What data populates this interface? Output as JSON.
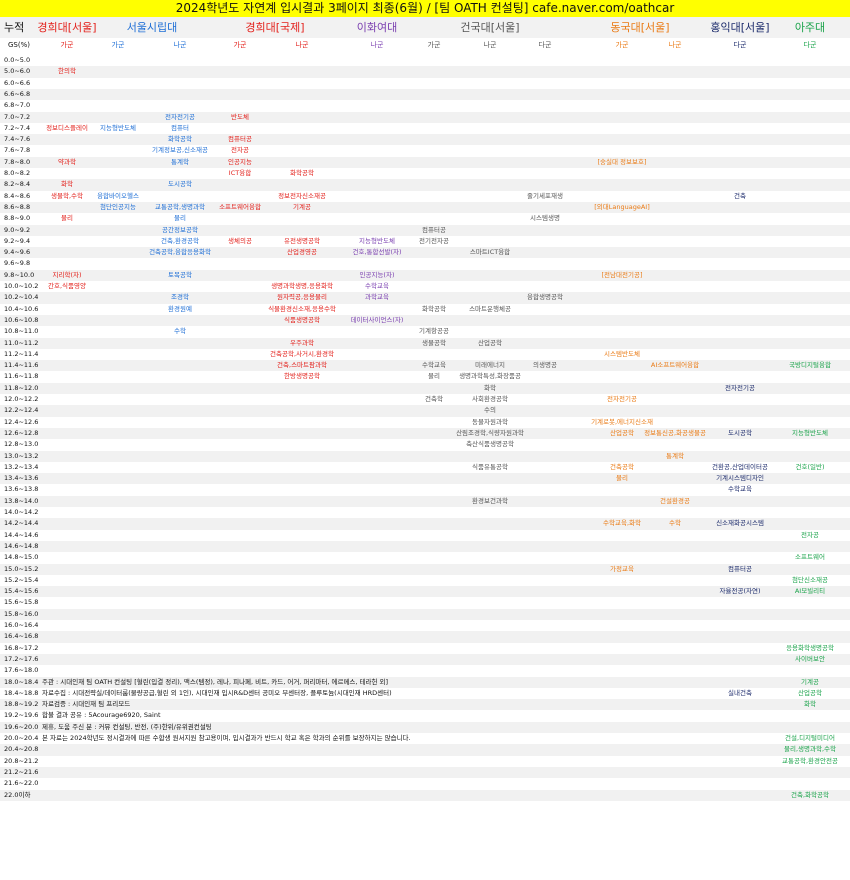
{
  "title": "2024학년도 자연계 입시결과 3페이지 최종(6월) / [팀 OATH 컨설팅] cafe.naver.com/oathcar",
  "header": {
    "corner": "누적",
    "corner2": "GS(%)",
    "universities": [
      {
        "name": "경희대[서울]",
        "color": "red"
      },
      {
        "name": "서울시립대",
        "color": "blue"
      },
      {
        "name": "경희대[국제]",
        "color": "red"
      },
      {
        "name": "이화여대",
        "color": "purple"
      },
      {
        "name": "건국대[서울]",
        "color": "gray"
      },
      {
        "name": "동국대[서울]",
        "color": "orange"
      },
      {
        "name": "홍익대[서울]",
        "color": "navy"
      },
      {
        "name": "아주대",
        "color": "green"
      }
    ],
    "groups": [
      {
        "label": "가군",
        "color": "red"
      },
      {
        "label": "가군",
        "color": "blue"
      },
      {
        "label": "나군",
        "color": "blue"
      },
      {
        "label": "가군",
        "color": "red"
      },
      {
        "label": "나군",
        "color": "red"
      },
      {
        "label": "나군",
        "color": "purple"
      },
      {
        "label": "가군",
        "color": "gray"
      },
      {
        "label": "나군",
        "color": "gray"
      },
      {
        "label": "다군",
        "color": "gray"
      },
      {
        "label": "가군",
        "color": "orange"
      },
      {
        "label": "나군",
        "color": "orange"
      },
      {
        "label": "다군",
        "color": "navy"
      },
      {
        "label": "다군",
        "color": "green"
      }
    ]
  },
  "rows": [
    {
      "label": "0.0~5.0",
      "cells": []
    },
    {
      "label": "5.0~6.0",
      "cells": [
        {
          "col": 0,
          "text": "한의학"
        }
      ]
    },
    {
      "label": "6.0~6.6",
      "cells": []
    },
    {
      "label": "6.6~6.8",
      "cells": []
    },
    {
      "label": "6.8~7.0",
      "cells": []
    },
    {
      "label": "7.0~7.2",
      "cells": [
        {
          "col": 2,
          "text": "전자전기공"
        },
        {
          "col": 3,
          "text": "반도체"
        }
      ]
    },
    {
      "label": "7.2~7.4",
      "cells": [
        {
          "col": 0,
          "text": "정보디스플레이"
        },
        {
          "col": 1,
          "text": "지능형반도체"
        },
        {
          "col": 2,
          "text": "컴퓨터"
        }
      ]
    },
    {
      "label": "7.4~7.6",
      "cells": [
        {
          "col": 2,
          "text": "화학공학"
        },
        {
          "col": 3,
          "text": "컴퓨터공"
        }
      ]
    },
    {
      "label": "7.6~7.8",
      "cells": [
        {
          "col": 2,
          "text": "기계정보공,신소재공"
        },
        {
          "col": 3,
          "text": "전자공"
        }
      ]
    },
    {
      "label": "7.8~8.0",
      "cells": [
        {
          "col": 0,
          "text": "약과학"
        },
        {
          "col": 2,
          "text": "통계학"
        },
        {
          "col": 3,
          "text": "인공지능"
        },
        {
          "col": 9,
          "text": "[숭실대 정보보호]"
        }
      ]
    },
    {
      "label": "8.0~8.2",
      "cells": [
        {
          "col": 3,
          "text": "ICT융합"
        },
        {
          "col": 4,
          "text": "화학공학"
        }
      ]
    },
    {
      "label": "8.2~8.4",
      "cells": [
        {
          "col": 0,
          "text": "화학"
        },
        {
          "col": 2,
          "text": "도시공학"
        }
      ]
    },
    {
      "label": "8.4~8.6",
      "cells": [
        {
          "col": 0,
          "text": "생물학,수학"
        },
        {
          "col": 1,
          "text": "융합바이오헬스"
        },
        {
          "col": 4,
          "text": "정보전자신소재공"
        },
        {
          "col": 8,
          "text": "줄기세포재생"
        },
        {
          "col": 11,
          "text": "건축"
        }
      ]
    },
    {
      "label": "8.6~8.8",
      "cells": [
        {
          "col": 1,
          "text": "첨단인공지능"
        },
        {
          "col": 2,
          "text": "교통공학,생명과학"
        },
        {
          "col": 3,
          "text": "소프트웨어융합"
        },
        {
          "col": 4,
          "text": "기계공"
        },
        {
          "col": 9,
          "text": "[외대LanguageAI]"
        }
      ]
    },
    {
      "label": "8.8~9.0",
      "cells": [
        {
          "col": 0,
          "text": "물리"
        },
        {
          "col": 2,
          "text": "물리"
        },
        {
          "col": 8,
          "text": "시스템생명"
        }
      ]
    },
    {
      "label": "9.0~9.2",
      "cells": [
        {
          "col": 2,
          "text": "공간정보공학"
        },
        {
          "col": 6,
          "text": "컴퓨터공"
        }
      ]
    },
    {
      "label": "9.2~9.4",
      "cells": [
        {
          "col": 2,
          "text": "건축,환경공학"
        },
        {
          "col": 3,
          "text": "생체의공"
        },
        {
          "col": 4,
          "text": "유전생명공학"
        },
        {
          "col": 5,
          "text": "지능형반도체"
        },
        {
          "col": 6,
          "text": "전기전자공"
        }
      ]
    },
    {
      "label": "9.4~9.6",
      "cells": [
        {
          "col": 2,
          "text": "건축공학,융합응용화학"
        },
        {
          "col": 4,
          "text": "산업경영공"
        },
        {
          "col": 5,
          "text": "건호,통합선발(자)"
        },
        {
          "col": 7,
          "text": "스마트ICT융합"
        }
      ]
    },
    {
      "label": "9.6~9.8",
      "cells": []
    },
    {
      "label": "9.8~10.0",
      "cells": [
        {
          "col": 0,
          "text": "지리학(자)"
        },
        {
          "col": 2,
          "text": "토목공학"
        },
        {
          "col": 5,
          "text": "인공지능(자)"
        },
        {
          "col": 9,
          "text": "[전남대전기공]"
        }
      ]
    },
    {
      "label": "10.0~10.2",
      "cells": [
        {
          "col": 0,
          "text": "간호,식품영양"
        },
        {
          "col": 4,
          "text": "생명과학생명,응용화학"
        },
        {
          "col": 5,
          "text": "수학교육"
        }
      ]
    },
    {
      "label": "10.2~10.4",
      "cells": [
        {
          "col": 2,
          "text": "조경학"
        },
        {
          "col": 4,
          "text": "원자력공,응용물리"
        },
        {
          "col": 5,
          "text": "과학교육"
        },
        {
          "col": 8,
          "text": "융합생명공학"
        }
      ]
    },
    {
      "label": "10.4~10.6",
      "cells": [
        {
          "col": 2,
          "text": "환경원예"
        },
        {
          "col": 4,
          "text": "식물환경신소재,응용수학"
        },
        {
          "col": 6,
          "text": "화학공학"
        },
        {
          "col": 7,
          "text": "스마트운행체공"
        }
      ]
    },
    {
      "label": "10.6~10.8",
      "cells": [
        {
          "col": 4,
          "text": "식품생명공학"
        },
        {
          "col": 5,
          "text": "데이터사이언스(자)"
        }
      ]
    },
    {
      "label": "10.8~11.0",
      "cells": [
        {
          "col": 2,
          "text": "수학"
        },
        {
          "col": 6,
          "text": "기계항공공"
        }
      ]
    },
    {
      "label": "11.0~11.2",
      "cells": [
        {
          "col": 4,
          "text": "우주과학"
        },
        {
          "col": 6,
          "text": "생물공학"
        },
        {
          "col": 7,
          "text": "산업공학"
        }
      ]
    },
    {
      "label": "11.2~11.4",
      "cells": [
        {
          "col": 4,
          "text": "건축공학,사거시,환경학"
        },
        {
          "col": 9,
          "text": "시스템반도체"
        }
      ]
    },
    {
      "label": "11.4~11.6",
      "cells": [
        {
          "col": 4,
          "text": "건축,스마트팜과학"
        },
        {
          "col": 6,
          "text": "수학교육"
        },
        {
          "col": 7,
          "text": "미래에너지"
        },
        {
          "col": 8,
          "text": "의생명공"
        },
        {
          "col": 10,
          "text": "AI소프트웨어융합"
        },
        {
          "col": 12,
          "text": "국방디지털융합"
        }
      ]
    },
    {
      "label": "11.6~11.8",
      "cells": [
        {
          "col": 4,
          "text": "한방생명공학"
        },
        {
          "col": 6,
          "text": "물리"
        },
        {
          "col": 7,
          "text": "생명과학특성,화장품공"
        }
      ]
    },
    {
      "label": "11.8~12.0",
      "cells": [
        {
          "col": 7,
          "text": "화학"
        },
        {
          "col": 11,
          "text": "전자전기공"
        }
      ]
    },
    {
      "label": "12.0~12.2",
      "cells": [
        {
          "col": 6,
          "text": "건축학"
        },
        {
          "col": 7,
          "text": "사회환경공학"
        },
        {
          "col": 9,
          "text": "전자전기공"
        }
      ]
    },
    {
      "label": "12.2~12.4",
      "cells": [
        {
          "col": 7,
          "text": "수의"
        }
      ]
    },
    {
      "label": "12.4~12.6",
      "cells": [
        {
          "col": 7,
          "text": "동물자원과학"
        },
        {
          "col": 9,
          "text": "기계로봇,에너지신소재"
        }
      ]
    },
    {
      "label": "12.6~12.8",
      "cells": [
        {
          "col": 7,
          "text": "산림조경학,식량자원과학"
        },
        {
          "col": 9,
          "text": "산업공학"
        },
        {
          "col": 10,
          "text": "정보통신공,화공생물공"
        },
        {
          "col": 11,
          "text": "도시공학"
        },
        {
          "col": 12,
          "text": "지능형반도체"
        }
      ]
    },
    {
      "label": "12.8~13.0",
      "cells": [
        {
          "col": 7,
          "text": "축산식품생명공학"
        }
      ]
    },
    {
      "label": "13.0~13.2",
      "cells": [
        {
          "col": 10,
          "text": "통계학"
        }
      ]
    },
    {
      "label": "13.2~13.4",
      "cells": [
        {
          "col": 7,
          "text": "식품유통공학"
        },
        {
          "col": 9,
          "text": "건축공학"
        },
        {
          "col": 11,
          "text": "건환공,산업데이터공"
        },
        {
          "col": 12,
          "text": "건호(일반)"
        }
      ]
    },
    {
      "label": "13.4~13.6",
      "cells": [
        {
          "col": 9,
          "text": "물리"
        },
        {
          "col": 11,
          "text": "기계시스템디자인"
        }
      ]
    },
    {
      "label": "13.6~13.8",
      "cells": [
        {
          "col": 11,
          "text": "수학교육"
        }
      ]
    },
    {
      "label": "13.8~14.0",
      "cells": [
        {
          "col": 7,
          "text": "환경보건과학"
        },
        {
          "col": 10,
          "text": "건설환경공"
        }
      ]
    },
    {
      "label": "14.0~14.2",
      "cells": []
    },
    {
      "label": "14.2~14.4",
      "cells": [
        {
          "col": 9,
          "text": "수학교육,화학"
        },
        {
          "col": 10,
          "text": "수학"
        },
        {
          "col": 11,
          "text": "신소재화공시스템"
        }
      ]
    },
    {
      "label": "14.4~14.6",
      "cells": [
        {
          "col": 12,
          "text": "전자공"
        }
      ]
    },
    {
      "label": "14.6~14.8",
      "cells": []
    },
    {
      "label": "14.8~15.0",
      "cells": [
        {
          "col": 12,
          "text": "소프트웨어"
        }
      ]
    },
    {
      "label": "15.0~15.2",
      "cells": [
        {
          "col": 9,
          "text": "가정교육"
        },
        {
          "col": 11,
          "text": "컴퓨터공"
        }
      ]
    },
    {
      "label": "15.2~15.4",
      "cells": [
        {
          "col": 12,
          "text": "첨단신소재공"
        }
      ]
    },
    {
      "label": "15.4~15.6",
      "cells": [
        {
          "col": 11,
          "text": "자율전공(자연)"
        },
        {
          "col": 12,
          "text": "AI모빌리티"
        }
      ]
    },
    {
      "label": "15.6~15.8",
      "cells": []
    },
    {
      "label": "15.8~16.0",
      "cells": []
    },
    {
      "label": "16.0~16.4",
      "cells": []
    },
    {
      "label": "16.4~16.8",
      "cells": []
    },
    {
      "label": "16.8~17.2",
      "cells": [
        {
          "col": 12,
          "text": "응용화학생명공학"
        }
      ]
    },
    {
      "label": "17.2~17.6",
      "cells": [
        {
          "col": 12,
          "text": "사이버보안"
        }
      ]
    },
    {
      "label": "17.6~18.0",
      "cells": []
    },
    {
      "label": "18.0~18.4",
      "note": "주관 : 시대인재 팀 OATH 컨설팅 [혈린(입결 정리), 맥스(템정), 레나, 피나페, 비트, 카드, 어거, 퍼리마터, 에르메스, 테라헌 외]",
      "cells": [
        {
          "col": 12,
          "text": "기계공"
        }
      ]
    },
    {
      "label": "18.4~18.8",
      "note": "자료수집 : 시대전략실/데이터룸(물량공급,혈린 외 1인), 시대인재 입시R&D센터 공미오 부센터장, 플루토늄(시대인재 HRD센터)",
      "cells": [
        {
          "col": 11,
          "text": "실내건축"
        },
        {
          "col": 12,
          "text": "산업공학"
        }
      ]
    },
    {
      "label": "18.8~19.2",
      "note": "자료검증 : 시대인재 팀 프리모드",
      "cells": [
        {
          "col": 12,
          "text": "화학"
        }
      ]
    },
    {
      "label": "19.2~19.6",
      "note": "합불 결과 공유 : 5Acourage6920, Saint",
      "cells": []
    },
    {
      "label": "19.6~20.0",
      "note": "제휴, 도움 주신 분 : 커뮤 컨설팅, 반전, (주)한위/유위권컨설팅",
      "cells": []
    },
    {
      "label": "20.0~20.4",
      "note": "본 자료는 2024학년도 정시결과에 따른 수합생 원서지원 참고용이며, 입시결과가 반드시 학교 혹은 학과의 순위를 보장하지는 않습니다.",
      "cells": [
        {
          "col": 12,
          "text": "건설,디지털미디어"
        }
      ]
    },
    {
      "label": "20.4~20.8",
      "cells": [
        {
          "col": 12,
          "text": "물리,생명과학,수학"
        }
      ]
    },
    {
      "label": "20.8~21.2",
      "cells": [
        {
          "col": 12,
          "text": "교통공학,환경안전공"
        }
      ]
    },
    {
      "label": "21.2~21.6",
      "cells": []
    },
    {
      "label": "21.6~22.0",
      "cells": []
    },
    {
      "label": "22.0이하",
      "cells": [
        {
          "col": 12,
          "text": "건축,화학공학"
        }
      ]
    }
  ]
}
